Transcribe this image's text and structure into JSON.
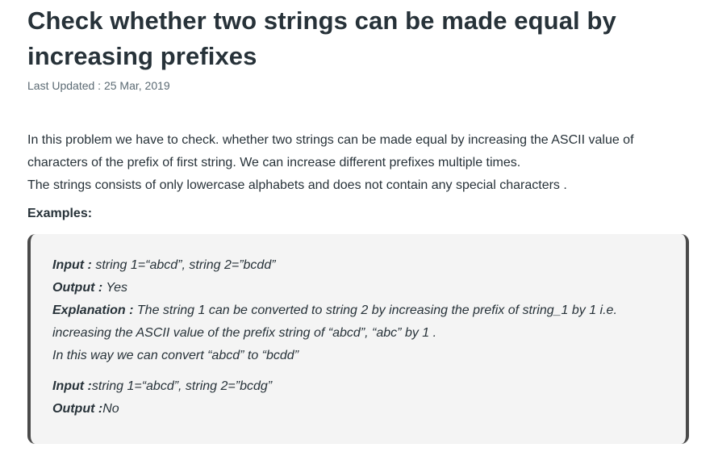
{
  "article": {
    "title": "Check whether two strings can be made equal by increasing prefixes",
    "last_updated": "Last Updated : 25 Mar, 2019",
    "intro": [
      "In this problem we have to check. whether two strings can be made equal by increasing the ASCII value of characters of the prefix of first string. We can increase different prefixes multiple times.",
      "The strings consists of only lowercase alphabets and does not contain any special characters ."
    ],
    "examples_heading": "Examples:",
    "examples": {
      "ex1_input_label": "Input :",
      "ex1_input_value": " string 1=“abcd”, string 2=”bcdd”",
      "ex1_output_label": "Output :",
      "ex1_output_value": " Yes",
      "ex1_explanation_label": "Explanation :",
      "ex1_explanation_line1": " The string 1 can be converted to string 2 by increasing the prefix of string_1 by 1 i.e.",
      "ex1_explanation_line2": "increasing the ASCII value of the prefix string of “abcd”, “abc” by 1 .",
      "ex1_explanation_line3": "In this way we can convert “abcd” to “bcdd”",
      "ex2_input_label": "Input :",
      "ex2_input_value": "string 1=“abcd”, string 2=”bcdg”",
      "ex2_output_label": "Output :",
      "ex2_output_value": "No"
    }
  }
}
